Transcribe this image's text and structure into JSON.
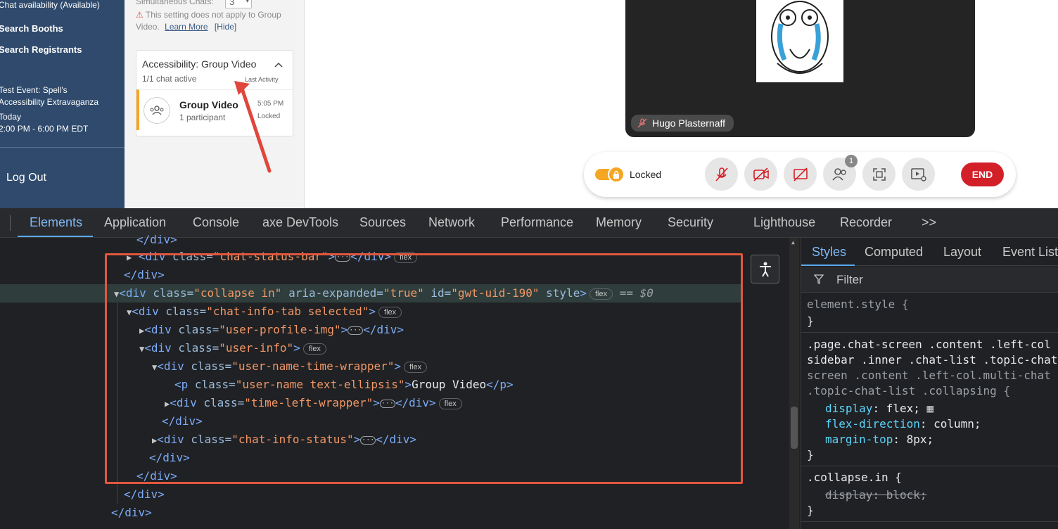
{
  "sidebar": {
    "chat_availability": "Chat availability (Available)",
    "search_booths": "Search Booths",
    "search_registrants": "Search Registrants",
    "event_name_line1": "Test Event: Spell's",
    "event_name_line2": "Accessibility Extravaganza",
    "event_day": "Today",
    "event_time": "2:00 PM - 6:00 PM EDT",
    "logout": "Log Out"
  },
  "panel": {
    "simultaneous_label": "Simultaneous Chats:",
    "simultaneous_value": "3",
    "warning_text_1": "This setting does not apply to Group",
    "warning_text_2": "Video.",
    "learn_more": "Learn More",
    "hide": "[Hide]",
    "card_title": "Accessibility: Group Video",
    "active_count": "1/1 chat active",
    "last_activity": "Last Activity",
    "chat_name": "Group Video",
    "participants": "1 participant",
    "time": "5:05 PM",
    "status": "Locked"
  },
  "video": {
    "participant_name": "Hugo Plasternaff"
  },
  "controls": {
    "locked_label": "Locked",
    "participant_count": "1",
    "end_label": "END",
    "end_color": "#d32028",
    "toggle_color": "#f5a623"
  },
  "devtools": {
    "tabs": [
      "Elements",
      "Application",
      "Console",
      "axe DevTools",
      "Sources",
      "Network",
      "Performance",
      "Memory",
      "Security",
      "Lighthouse",
      "Recorder",
      ">>"
    ],
    "active_tab": "Elements",
    "styles_tabs": [
      "Styles",
      "Computed",
      "Layout",
      "Event Liste"
    ],
    "filter_placeholder": "Filter",
    "dom": {
      "l0": "</div>",
      "l1_tag": "<div ",
      "l1_attr": "class=",
      "l1_val": "\"chat-status-bar\"",
      "l2": "</div>",
      "l3_val_class": "\"collapse in\"",
      "l3_val_aria": "\"true\"",
      "l3_val_id": "\"gwt-uid-190\"",
      "l3_eq": "== $0",
      "l4_val": "\"chat-info-tab selected\"",
      "l5_val": "\"user-profile-img\"",
      "l6_val": "\"user-info\"",
      "l7_val": "\"user-name-time-wrapper\"",
      "l8_val": "\"user-name text-ellipsis\"",
      "l8_text": "Group Video",
      "l9_val": "\"time-left-wrapper\"",
      "l10": "</div>",
      "l11_val": "\"chat-info-status\"",
      "l12": "</div>",
      "l13": "</div>",
      "l14": "</div>",
      "l15": "</div>",
      "flex": "flex"
    },
    "styles": {
      "element_style": "element.style {",
      "close": "}",
      "rule2_sel_1": ".page.chat-screen .content .left-col",
      "rule2_sel_2": "sidebar .inner .chat-list .topic-chat",
      "rule2_sel_3": "screen .content .left-col.multi-chat",
      "rule2_sel_4": ".topic-chat-list .collapsing {",
      "display": "display",
      "display_val": "flex;",
      "flex_direction": "flex-direction",
      "flex_direction_val": "column;",
      "margin_top": "margin-top",
      "margin_top_val": "8px;",
      "rule3_sel": ".collapse.in {",
      "block_display": "display: block;"
    }
  }
}
